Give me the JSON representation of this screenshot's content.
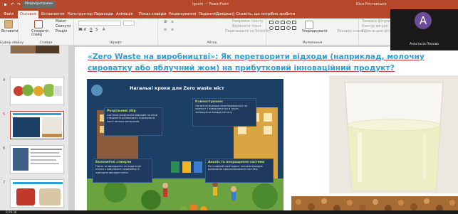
{
  "titlebar": {
    "document": "Igcore — PowerPoint",
    "user": "Юся Ристевська",
    "meeting_tag": "Медіапрограван"
  },
  "tabs": [
    "Файл",
    "Основне",
    "Вставлення",
    "Конструктор",
    "Переходи",
    "Анімація",
    "Показ слайдів",
    "Рецензування",
    "Подання",
    "Довідка"
  ],
  "active_tab": "Основне",
  "tell_me": "Скажіть, що потрібно зробити",
  "ribbon": {
    "clipboard": {
      "paste": "Вставити",
      "label": "Буфер обміну"
    },
    "slides": {
      "new_slide": "Створити слайд",
      "layout": "Макет",
      "reset": "Скинути",
      "section": "Розділ",
      "label": "Слайди"
    },
    "font": {
      "label": "Шрифт"
    },
    "paragraph": {
      "text_direction": "Напрямок тексту",
      "align_text": "Вирівняти текст",
      "smartart": "Перетворити на SmartArt",
      "label": "Абзац"
    },
    "drawing": {
      "arrange": "Упорядкувати",
      "quick_styles": "Експрес-стилі",
      "label": "Малювання"
    },
    "editing": {
      "fill": "Заливка фігури",
      "outline": "Контур фігури",
      "effects": "Ефекти для фігури"
    }
  },
  "slides": [
    {
      "number": "4"
    },
    {
      "number": "5"
    },
    {
      "number": "6"
    },
    {
      "number": "7"
    }
  ],
  "selected_slide": "5",
  "slide": {
    "title_part1": "«Zero Waste на виробництві»",
    "title_part2": ": Як перетворити відходи (наприклад, молочну сироватку або яблучний жом) на прибутковий інноваційний продукт?",
    "infographic": {
      "heading": "Нагальні кроки для Zero waste міст",
      "boxes": [
        {
          "title": "Роздільний збір",
          "text": "Системи розділення відходів на місці утворення дозволяють отримувати чисті потоки матеріалів."
        },
        {
          "title": "Компостування",
          "text": "Органічні відходи перетворюються на компост і повертаються в ґрунт, зменшуючи викиди метану."
        },
        {
          "title": "Економічні стимули",
          "text": "Плата за викидання та податкові пільги стимулюють переробку й повторне використання."
        },
        {
          "title": "Аналіз та покращення системи",
          "text": "Регулярний моніторинг потоків відходів допомагає вдосконалювати систему."
        }
      ]
    }
  },
  "video": {
    "initial": "A",
    "name": "Анастасія Попова"
  },
  "status": {
    "time": "0:29:36"
  },
  "colors": {
    "accent": "#b7472a",
    "title": "#2aa3d6",
    "infographic_bg": "#1c3f66"
  }
}
